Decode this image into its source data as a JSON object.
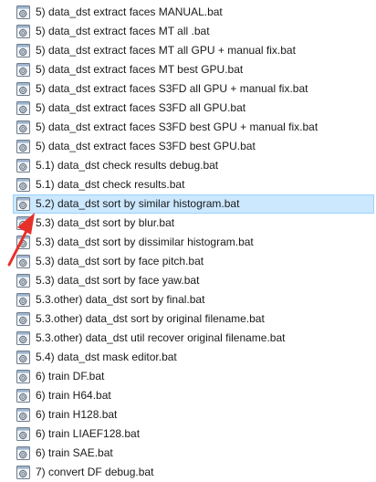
{
  "files": [
    {
      "name": "5) data_dst extract faces MANUAL.bat",
      "selected": false
    },
    {
      "name": "5) data_dst extract faces MT all .bat",
      "selected": false
    },
    {
      "name": "5) data_dst extract faces MT all GPU + manual fix.bat",
      "selected": false
    },
    {
      "name": "5) data_dst extract faces MT best GPU.bat",
      "selected": false
    },
    {
      "name": "5) data_dst extract faces S3FD all GPU + manual fix.bat",
      "selected": false
    },
    {
      "name": "5) data_dst extract faces S3FD all GPU.bat",
      "selected": false
    },
    {
      "name": "5) data_dst extract faces S3FD best GPU + manual fix.bat",
      "selected": false
    },
    {
      "name": "5) data_dst extract faces S3FD best GPU.bat",
      "selected": false
    },
    {
      "name": "5.1) data_dst check results debug.bat",
      "selected": false
    },
    {
      "name": "5.1) data_dst check results.bat",
      "selected": false
    },
    {
      "name": "5.2) data_dst sort by similar histogram.bat",
      "selected": true
    },
    {
      "name": "5.3) data_dst sort by blur.bat",
      "selected": false
    },
    {
      "name": "5.3) data_dst sort by dissimilar histogram.bat",
      "selected": false
    },
    {
      "name": "5.3) data_dst sort by face pitch.bat",
      "selected": false
    },
    {
      "name": "5.3) data_dst sort by face yaw.bat",
      "selected": false
    },
    {
      "name": "5.3.other) data_dst sort by final.bat",
      "selected": false
    },
    {
      "name": "5.3.other) data_dst sort by original filename.bat",
      "selected": false
    },
    {
      "name": "5.3.other) data_dst util recover original filename.bat",
      "selected": false
    },
    {
      "name": "5.4) data_dst mask editor.bat",
      "selected": false
    },
    {
      "name": "6) train DF.bat",
      "selected": false
    },
    {
      "name": "6) train H64.bat",
      "selected": false
    },
    {
      "name": "6) train H128.bat",
      "selected": false
    },
    {
      "name": "6) train LIAEF128.bat",
      "selected": false
    },
    {
      "name": "6) train SAE.bat",
      "selected": false
    },
    {
      "name": "7) convert DF debug.bat",
      "selected": false
    }
  ],
  "file_icon": "batch-file-gear-icon",
  "annotation": {
    "icon": "red-arrow-icon",
    "color": "#e8302a"
  },
  "colors": {
    "selection_fill": "#cce8ff",
    "selection_border": "#99d1ff",
    "text": "#1a1a1a"
  }
}
